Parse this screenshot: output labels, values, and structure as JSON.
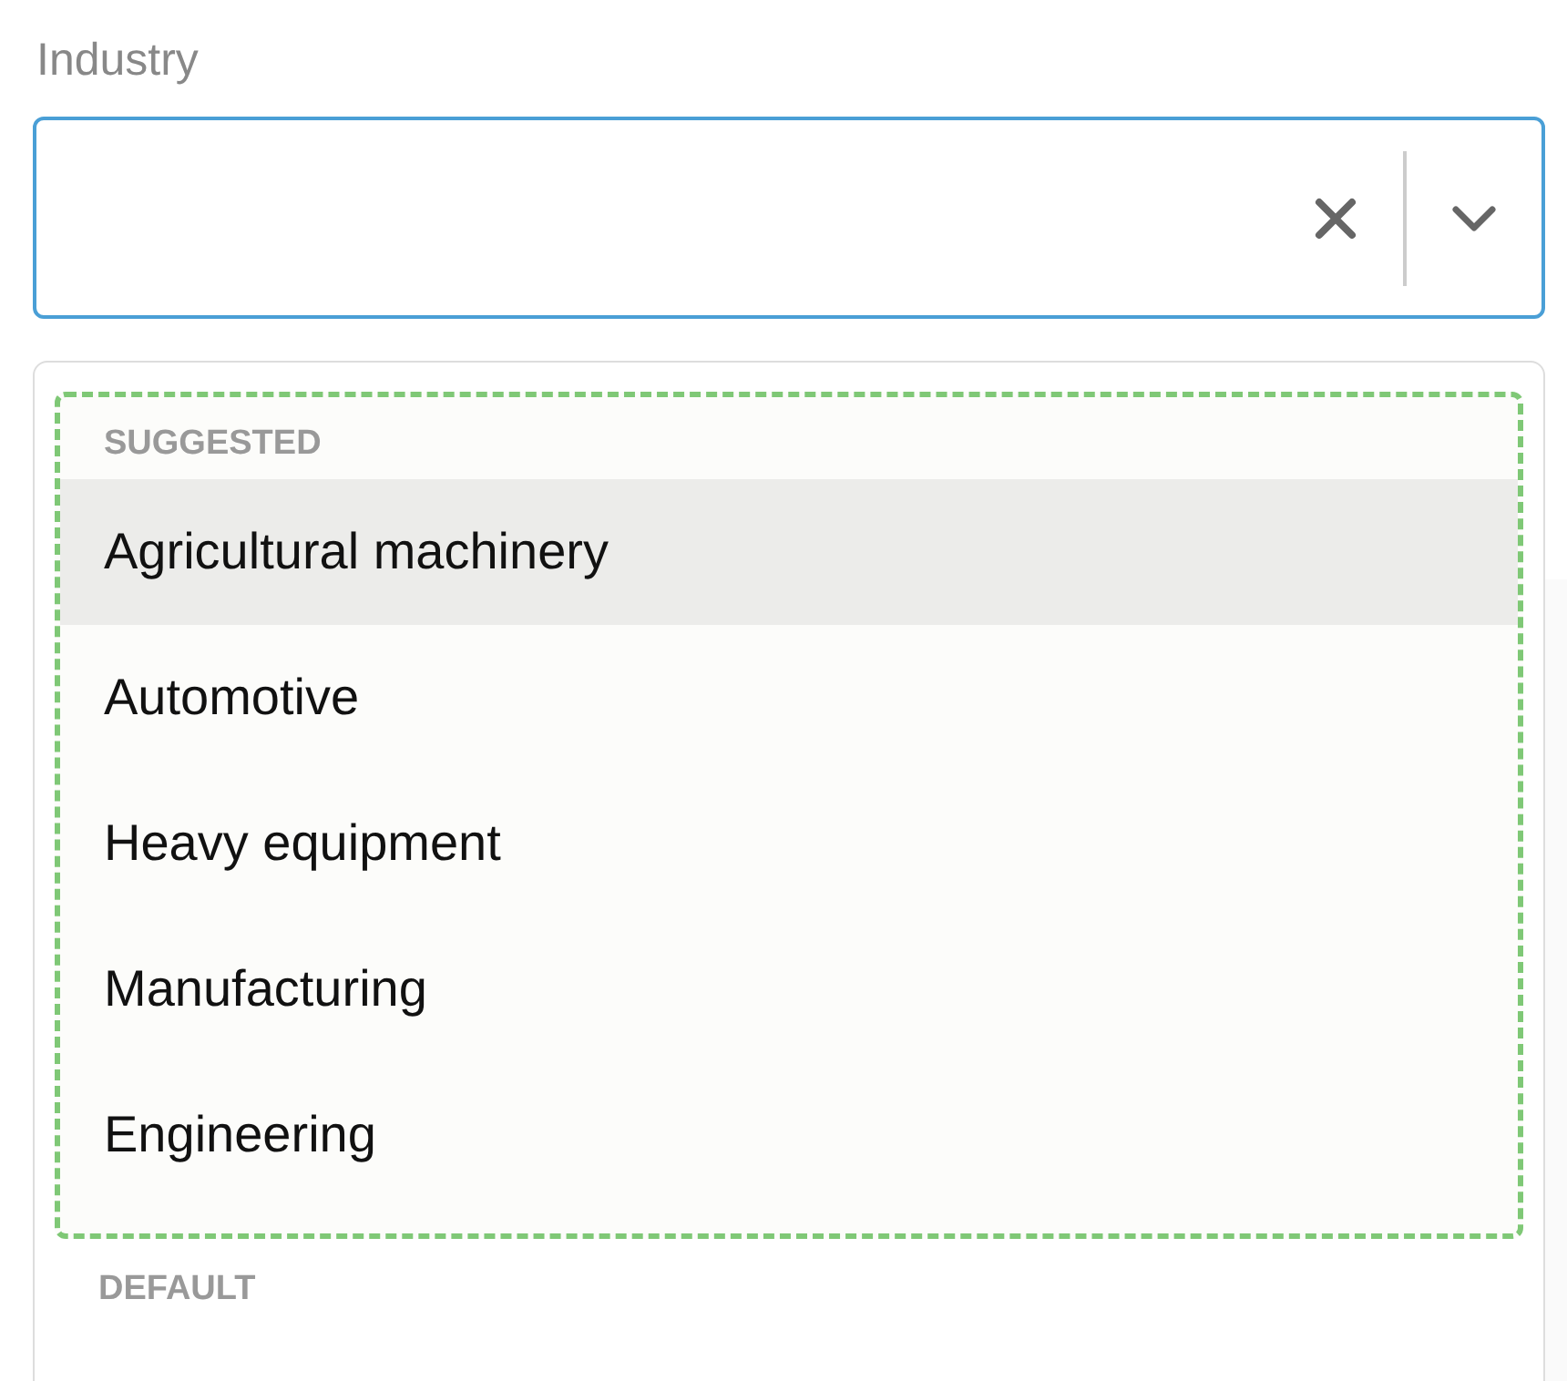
{
  "field": {
    "label": "Industry",
    "focused": true
  },
  "dropdown": {
    "groups": [
      {
        "heading": "SUGGESTED",
        "outlined": true,
        "options": [
          {
            "label": "Agricultural machinery",
            "selected": true
          },
          {
            "label": "Automotive",
            "selected": false
          },
          {
            "label": "Heavy equipment",
            "selected": false
          },
          {
            "label": "Manufacturing",
            "selected": false
          },
          {
            "label": "Engineering",
            "selected": false
          }
        ]
      },
      {
        "heading": "DEFAULT",
        "outlined": false
      }
    ]
  }
}
